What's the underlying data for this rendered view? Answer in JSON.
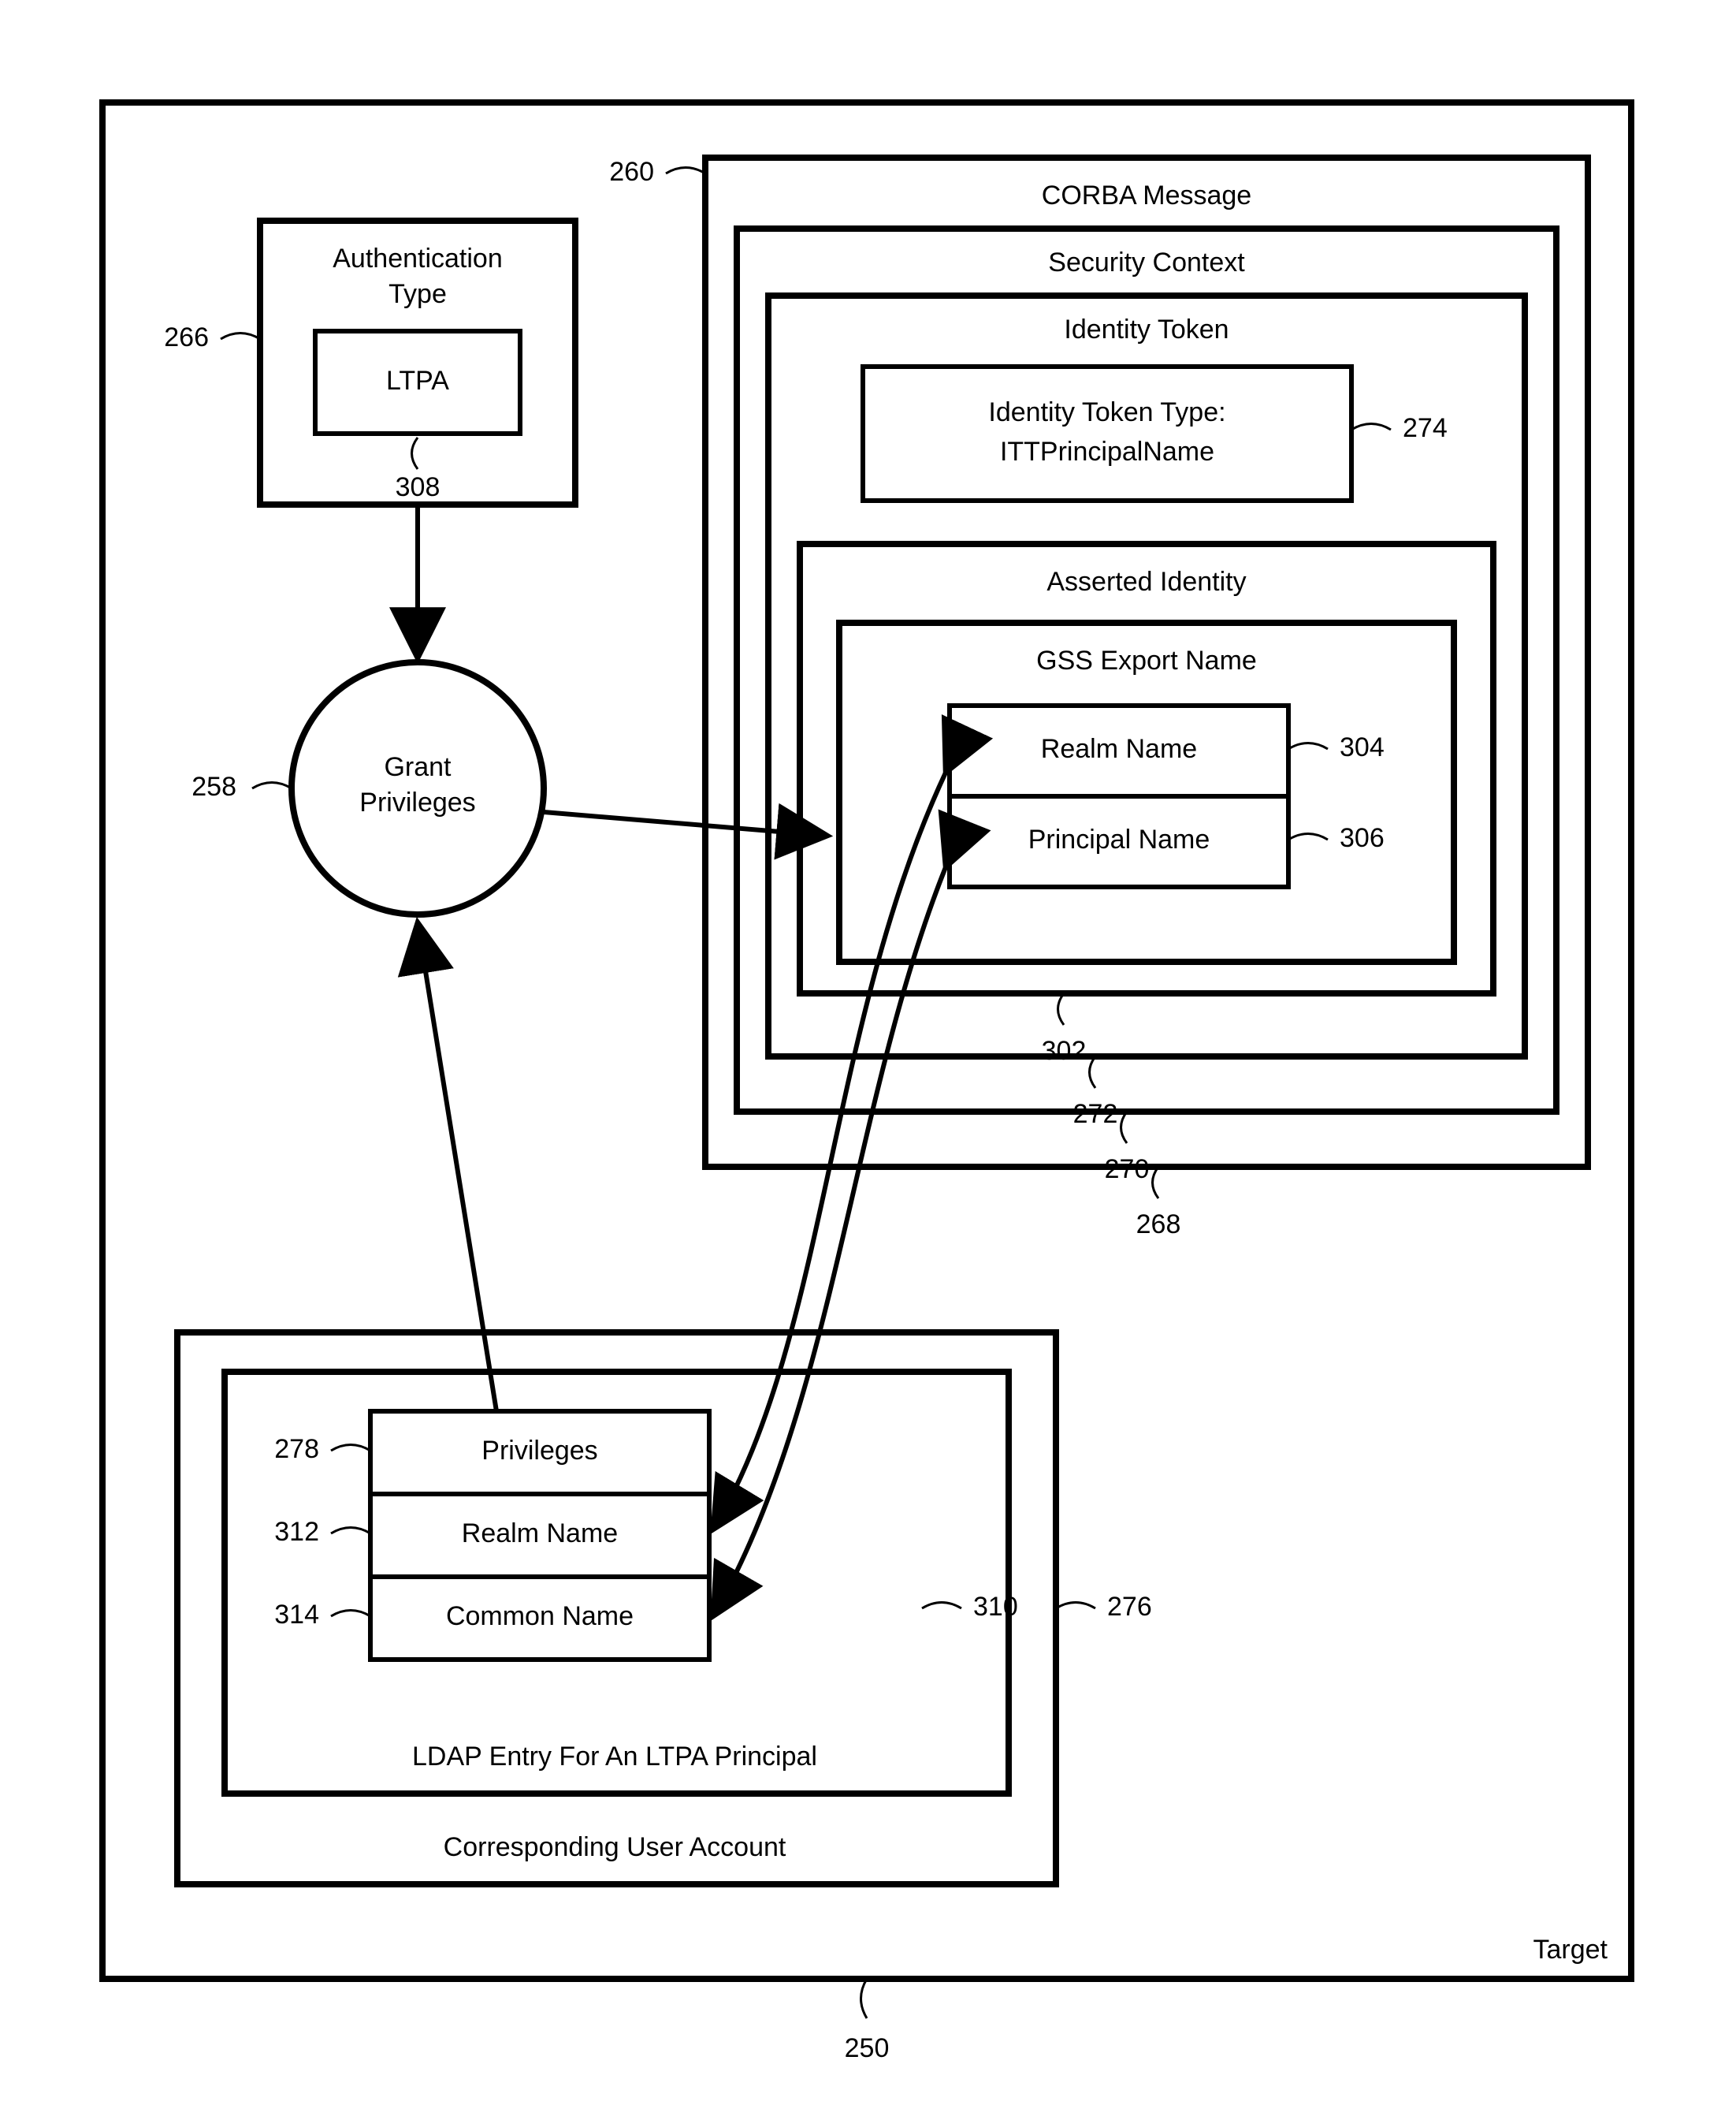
{
  "outer": {
    "label": "Target",
    "ref": "250"
  },
  "authType": {
    "title": "Authentication Type",
    "value": "LTPA",
    "refBox": "266",
    "refVal": "308"
  },
  "grant": {
    "label": "Grant Privileges",
    "ref": "258"
  },
  "msg": {
    "corba": {
      "title": "CORBA Message",
      "ref": "268",
      "titleRef": "260"
    },
    "secctx": {
      "title": "Security Context",
      "ref": "270"
    },
    "idtoken": {
      "title": "Identity Token",
      "ref": "272"
    },
    "idtype": {
      "line1": "Identity Token Type:",
      "line2": "ITTPrincipalName",
      "ref": "274"
    },
    "asserted": {
      "title": "Asserted Identity",
      "ref": "302"
    },
    "gss": {
      "title": "GSS Export Name",
      "realm": "Realm Name",
      "refRealm": "304",
      "principal": "Principal Name",
      "refPrincipal": "306"
    }
  },
  "account": {
    "title": "Corresponding User Account",
    "ref": "276",
    "ldap": {
      "title": "LDAP Entry For An LTPA Principal",
      "ref": "310"
    },
    "priv": {
      "label": "Privileges",
      "ref": "278"
    },
    "realm": {
      "label": "Realm Name",
      "ref": "312"
    },
    "common": {
      "label": "Common Name",
      "ref": "314"
    }
  }
}
